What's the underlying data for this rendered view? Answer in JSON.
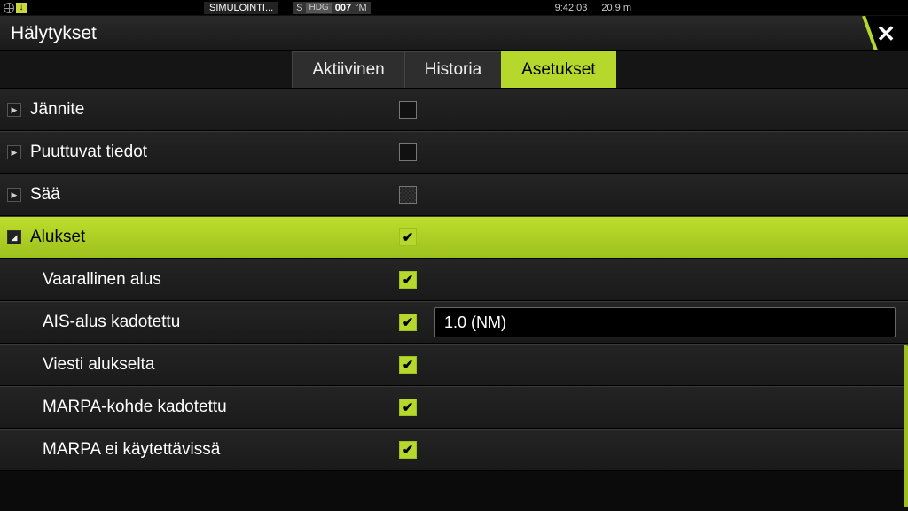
{
  "statusbar": {
    "sim": "SIMULOINTI...",
    "hdg_prefix": "S",
    "hdg_label": "HDG",
    "hdg_value": "007",
    "hdg_unit": "°M",
    "time": "9:42:03",
    "depth": "20.9 m"
  },
  "titlebar": {
    "title": "Hälytykset"
  },
  "tabs": {
    "active": "Aktiivinen",
    "history": "Historia",
    "settings": "Asetukset"
  },
  "rows": {
    "voltage": "Jännite",
    "missing_data": "Puuttuvat tiedot",
    "weather": "Sää",
    "vessels": "Alukset",
    "dangerous_vessel": "Vaarallinen alus",
    "ais_lost": "AIS-alus kadotettu",
    "ais_lost_value": "1.0 (NM)",
    "vessel_message": "Viesti alukselta",
    "marpa_lost": "MARPA-kohde kadotettu",
    "marpa_unavail": "MARPA ei käytettävissä"
  }
}
